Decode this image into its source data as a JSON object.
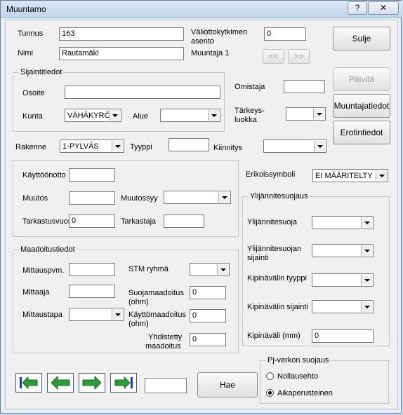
{
  "window": {
    "title": "Muuntamo",
    "help_label": "?",
    "close_label": "✕"
  },
  "header": {
    "tunnus_label": "Tunnus",
    "tunnus_value": "163",
    "nimi_label": "Nimi",
    "nimi_value": "Rautamäki",
    "valiotto_label_1": "Väliottokytkimen",
    "valiotto_label_2": "asento",
    "valiotto_value": "0",
    "muuntaja_label": "Muuntaja 1",
    "prev_label": "<<",
    "next_label": ">>"
  },
  "buttons": {
    "sulje": "Sulje",
    "paivita": "Päivitä",
    "muuntajatiedot": "Muuntajatiedot",
    "erotintiedot": "Erotintiedot",
    "hae": "Hae"
  },
  "sijainti": {
    "group_title": "Sijaintitiedot",
    "osoite_label": "Osoite",
    "osoite_value": "",
    "kunta_label": "Kunta",
    "kunta_value": "VÄHÄKYRÖ",
    "alue_label": "Alue",
    "alue_value": ""
  },
  "omistaja": {
    "label": "Omistaja",
    "value": "",
    "tarkeys_label_1": "Tärkeys-",
    "tarkeys_label_2": "luokka",
    "tarkeys_value": ""
  },
  "rakenne": {
    "label": "Rakenne",
    "value": "1-PYLVÄS",
    "tyyppi_label": "Tyyppi",
    "tyyppi_value": "",
    "kiinnitys_label": "Kiinnitys",
    "kiinnitys_value": ""
  },
  "kaytto": {
    "kayttoonotto_label": "Käyttöönotto",
    "kayttoonotto_value": "",
    "muutos_label": "Muutos",
    "muutos_value": "",
    "muutossyy_label": "Muutossyy",
    "muutossyy_value": "",
    "tarkastusvuosi_label": "Tarkastusvuosi",
    "tarkastusvuosi_value": "0",
    "tarkastaja_label": "Tarkastaja",
    "tarkastaja_value": ""
  },
  "maadoitus": {
    "group_title": "Maadoitustiedot",
    "mittauspvm_label": "Mittauspvm.",
    "mittauspvm_value": "",
    "stm_label": "STM ryhmä",
    "stm_value": "",
    "mittaaja_label": "Mittaaja",
    "mittaaja_value": "",
    "suojamaadoitus_label_1": "Suojamaadoitus",
    "suojamaadoitus_label_2": "(ohm)",
    "suojamaadoitus_value": "0",
    "mittaustapa_label": "Mittaustapa",
    "mittaustapa_value": "",
    "kayttomaadoitus_label_1": "Käyttömaadoitus",
    "kayttomaadoitus_label_2": "(ohm)",
    "kayttomaadoitus_value": "0",
    "yhdistetty_label_1": "Yhdistetty",
    "yhdistetty_label_2": "maadoitus",
    "yhdistetty_value": "0"
  },
  "erikoissymboli": {
    "label": "Erikoissymboli",
    "value": "EI MÄÄRITELTY"
  },
  "ylijannite": {
    "group_title": "Ylijännitesuojaus",
    "suoja_label": "Ylijännitesuoja",
    "suoja_value": "",
    "sijainti_label_1": "Ylijännitesuojan",
    "sijainti_label_2": "sijainti",
    "sijainti_value": "",
    "kipinavalin_tyyppi_label": "Kipinävälin tyyppi",
    "kipinavalin_tyyppi_value": "",
    "kipinavalin_sijainti_label": "Kipinävälin sijainti",
    "kipinavalin_sijainti_value": "",
    "kipinavali_label": "Kipinäväli (mm)",
    "kipinavali_value": "0"
  },
  "pj": {
    "group_title": "Pj-verkon suojaus",
    "options": [
      "Nollausehto",
      "Aikaperusteinen"
    ],
    "selected": "Aikaperusteinen"
  },
  "nav": {
    "icons": [
      "first-record-icon",
      "previous-record-icon",
      "next-record-icon",
      "last-record-icon"
    ],
    "record_value": ""
  },
  "colors": {
    "nav_arrow": "#2e9a3a",
    "nav_bar": "#1f3fa8",
    "window_frame": "#c9dbee"
  }
}
